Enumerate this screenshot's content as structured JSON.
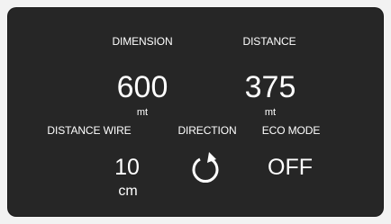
{
  "dimension": {
    "label": "DIMENSION",
    "value": "600",
    "unit": "mt"
  },
  "distance": {
    "label": "DISTANCE",
    "value": "375",
    "unit": "mt"
  },
  "distance_wire": {
    "label": "DISTANCE WIRE",
    "value": "10",
    "unit": "cm"
  },
  "direction": {
    "label": "DIRECTION",
    "icon": "rotate-clockwise-icon"
  },
  "eco_mode": {
    "label": "ECO MODE",
    "value": "OFF"
  },
  "colors": {
    "background": "#262626",
    "text": "#ffffff"
  }
}
